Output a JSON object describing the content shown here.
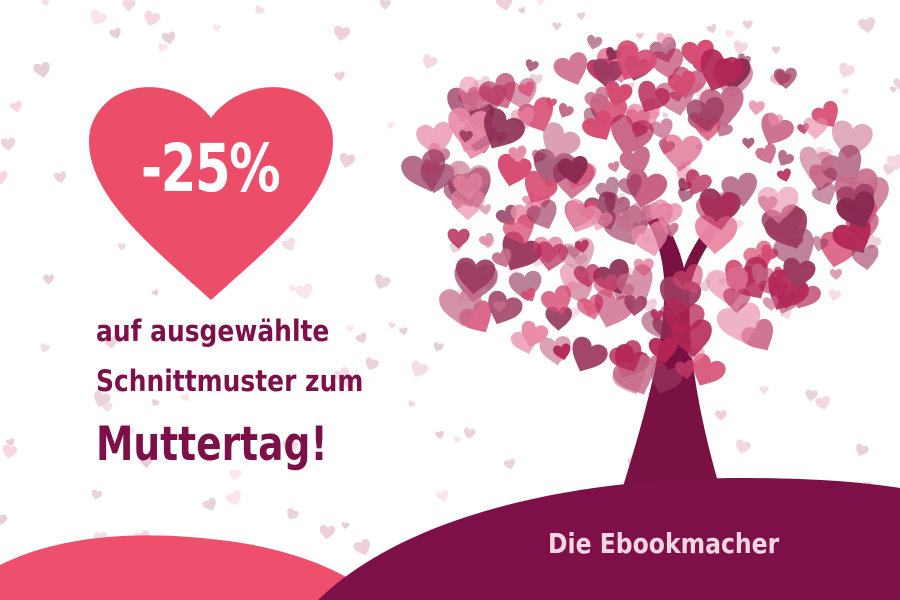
{
  "promo": {
    "discount": "-25%",
    "line1": "auf ausgewählte",
    "line2": "Schnittmuster zum",
    "line3": "Muttertag!"
  },
  "brand": {
    "name": "Die Ebookmacher"
  },
  "colors": {
    "heart": "#ec4d69",
    "text": "#7e1049",
    "hill_dark": "#7e1049",
    "hill_light": "#ee4f6c",
    "trunk": "#7a1143",
    "brand_text": "#f7d6e2",
    "tree_hearts": [
      "#b42656",
      "#d64b72",
      "#9c3a62",
      "#e889a6",
      "#c66a8a",
      "#8a2a52"
    ]
  },
  "icons": {
    "badge": "heart-icon",
    "tree": "heart-tree-illustration"
  }
}
